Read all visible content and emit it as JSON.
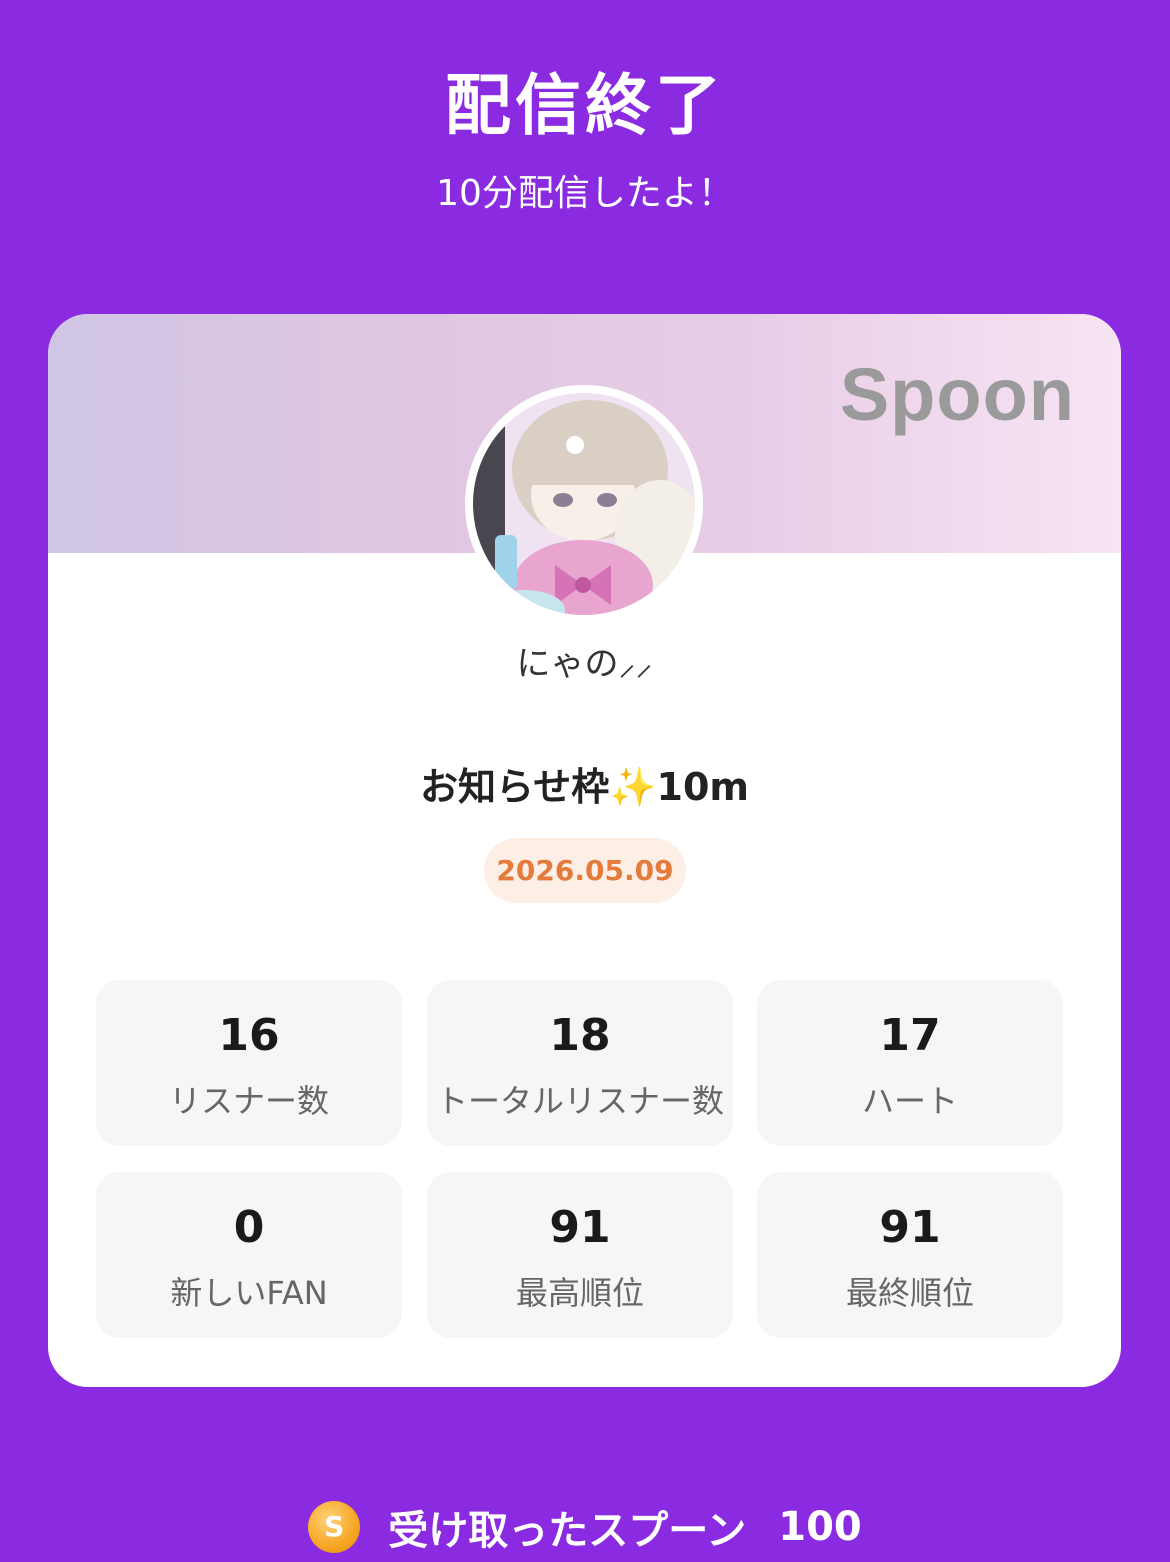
{
  "header": {
    "title": "配信終了",
    "subtitle": "10分配信したよ！"
  },
  "card": {
    "brand": "Spoon",
    "username": "にゃの⸝⸝",
    "stream_title": "お知らせ枠✨10m",
    "date": "2026.05.09",
    "stats": [
      {
        "value": "16",
        "label": "リスナー数"
      },
      {
        "value": "18",
        "label": "トータルリスナー数"
      },
      {
        "value": "17",
        "label": "ハート"
      },
      {
        "value": "0",
        "label": "新しいFAN"
      },
      {
        "value": "91",
        "label": "最高順位"
      },
      {
        "value": "91",
        "label": "最終順位"
      }
    ]
  },
  "footer": {
    "coin_symbol": "S",
    "label": "受け取ったスプーン",
    "value": "100"
  },
  "colors": {
    "background": "#8a2be2",
    "date_text": "#e47a3c",
    "coin": "#f6a623"
  }
}
